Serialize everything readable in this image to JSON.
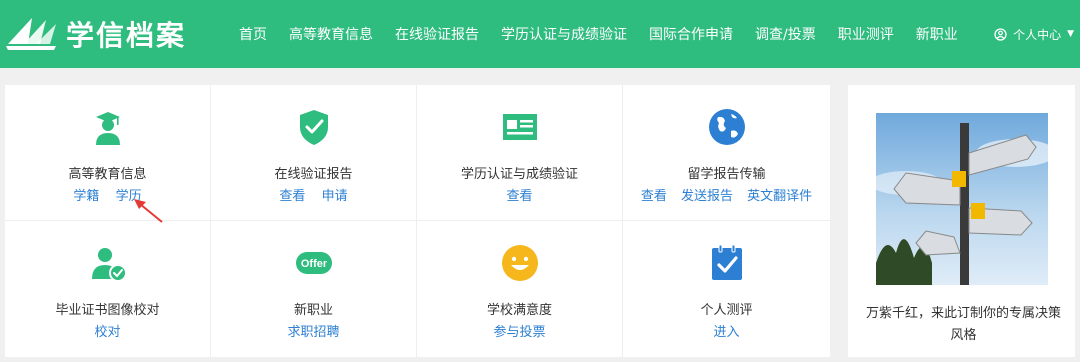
{
  "header": {
    "logo_text": "学信档案",
    "nav": [
      "首页",
      "高等教育信息",
      "在线验证报告",
      "学历认证与成绩验证",
      "国际合作申请",
      "调查/投票",
      "职业测评",
      "新职业"
    ],
    "user_menu": "个人中心"
  },
  "grid": [
    {
      "title": "高等教育信息",
      "links": [
        "学籍",
        "学历"
      ],
      "icon": "graduate-icon"
    },
    {
      "title": "在线验证报告",
      "links": [
        "查看",
        "申请"
      ],
      "icon": "shield-check-icon"
    },
    {
      "title": "学历认证与成绩验证",
      "links": [
        "查看"
      ],
      "icon": "id-card-icon"
    },
    {
      "title": "留学报告传输",
      "links": [
        "查看",
        "发送报告",
        "英文翻译件"
      ],
      "icon": "globe-icon"
    },
    {
      "title": "毕业证书图像校对",
      "links": [
        "校对"
      ],
      "icon": "user-check-icon"
    },
    {
      "title": "新职业",
      "links": [
        "求职招聘"
      ],
      "icon": "offer-icon"
    },
    {
      "title": "学校满意度",
      "links": [
        "参与投票"
      ],
      "icon": "smiley-icon"
    },
    {
      "title": "个人测评",
      "links": [
        "进入"
      ],
      "icon": "clipboard-check-icon"
    }
  ],
  "offer_badge": "Offer",
  "ad": {
    "text": "万紫千红，来此订制你的专属决策风格"
  },
  "colors": {
    "brand": "#2ebc7f",
    "link": "#2d7fd3",
    "arrow": "#e53935"
  }
}
